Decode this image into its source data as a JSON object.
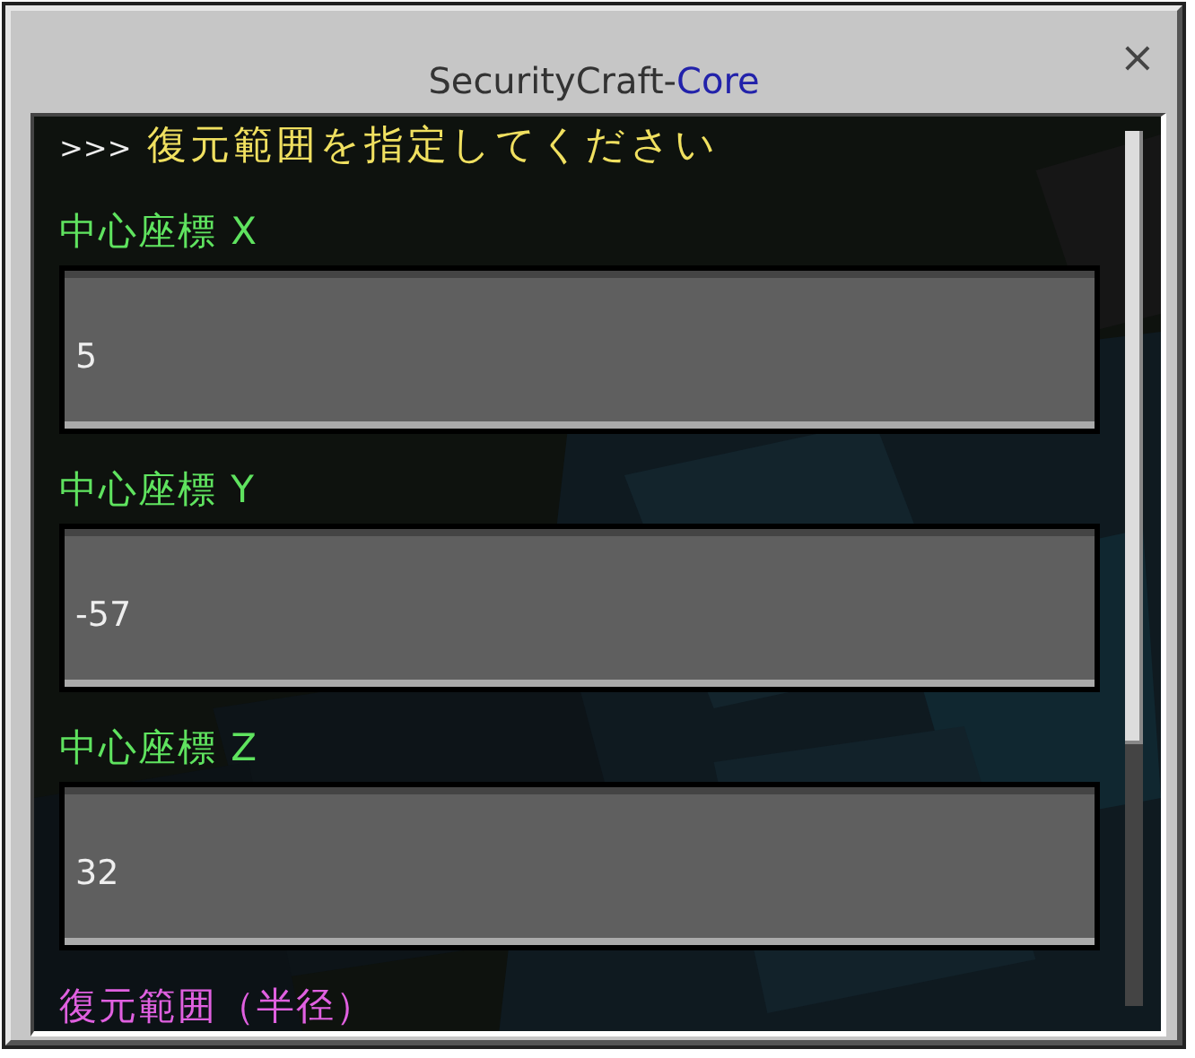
{
  "window": {
    "title": "SecurityCraft-",
    "title_accent": "Core",
    "close": "×"
  },
  "prompt": {
    "marker": ">>>",
    "text": "復元範囲を指定してください"
  },
  "fields": [
    {
      "kind": "field",
      "label": "中心座標 X",
      "color": "#5fe35f",
      "value": "5"
    },
    {
      "kind": "field",
      "label": "中心座標 Y",
      "color": "#5fe35f",
      "value": "-57"
    },
    {
      "kind": "field",
      "label": "中心座標 Z",
      "color": "#5fe35f",
      "value": "32"
    },
    {
      "kind": "heading",
      "label": "復元範囲（半径）",
      "color": "#e060e0"
    }
  ]
}
